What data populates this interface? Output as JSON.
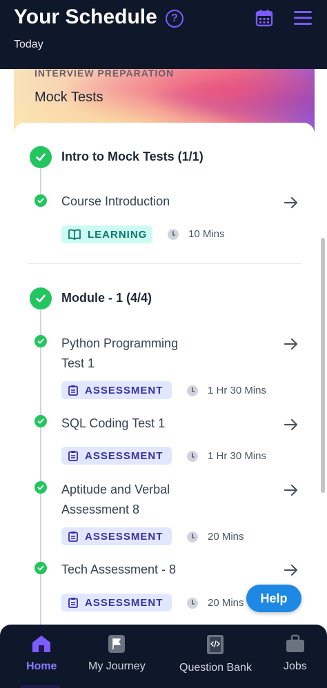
{
  "header": {
    "title": "Your Schedule",
    "subtitle": "Today",
    "help_icon": "question-circle-icon",
    "calendar_icon": "calendar-icon",
    "menu_icon": "hamburger-menu-icon",
    "accent_color": "#7c5cff"
  },
  "course": {
    "kicker": "INTERVIEW PREPARATION",
    "title": "Mock Tests"
  },
  "modules": [
    {
      "title": "Intro to Mock Tests (1/1)",
      "items": [
        {
          "title": "Course Introduction",
          "tag": "LEARNING",
          "duration": "10 Mins"
        }
      ]
    },
    {
      "title": "Module - 1 (4/4)",
      "items": [
        {
          "title": "Python Programming Test 1",
          "tag": "ASSESSMENT",
          "duration": "1 Hr 30 Mins"
        },
        {
          "title": "SQL Coding Test 1",
          "tag": "ASSESSMENT",
          "duration": "1 Hr 30 Mins"
        },
        {
          "title": "Aptitude and Verbal Assessment 8",
          "tag": "ASSESSMENT",
          "duration": "20 Mins"
        },
        {
          "title": "Tech Assessment - 8",
          "tag": "ASSESSMENT",
          "duration": "20 Mins"
        }
      ]
    }
  ],
  "help_button": "Help",
  "nav": [
    {
      "label": "Home",
      "icon": "home-icon",
      "active": true
    },
    {
      "label": "My Journey",
      "icon": "flag-icon",
      "active": false
    },
    {
      "label": "Question Bank",
      "icon": "code-book-icon",
      "active": false
    },
    {
      "label": "Jobs",
      "icon": "briefcase-icon",
      "active": false
    }
  ],
  "colors": {
    "header_bg": "#0f172a",
    "success": "#22c55e",
    "learning_tag_bg": "#ccfbf1",
    "learning_tag_text": "#0f766e",
    "assessment_tag_bg": "#e0e7ff",
    "assessment_tag_text": "#3730a3",
    "help_button": "#1e88e5"
  }
}
